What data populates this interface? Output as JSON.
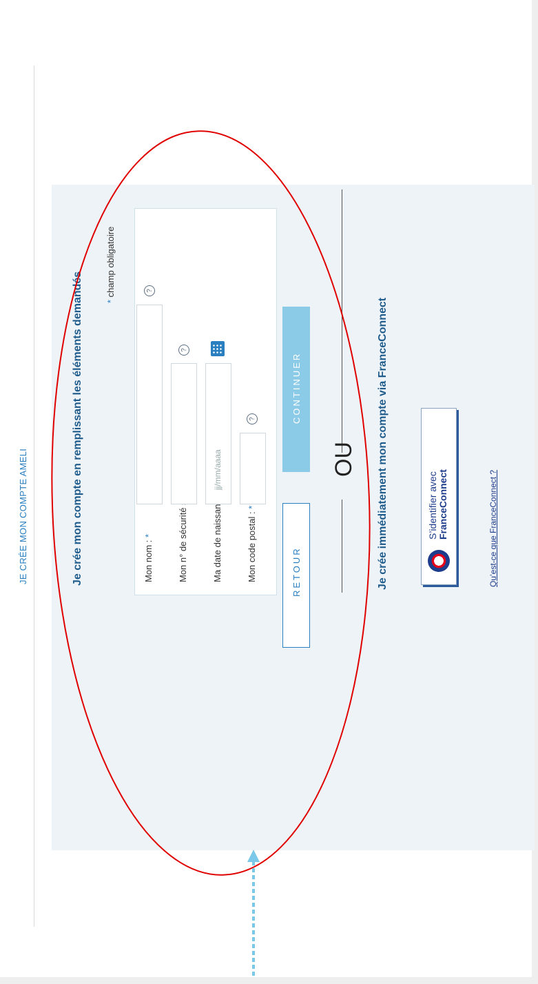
{
  "page": {
    "title": "JE CRÉE MON COMPTE AMELI"
  },
  "form": {
    "title": "Je crée mon compte en remplissant les éléments demandés",
    "required_note": "champ obligatoire",
    "required_star": "*",
    "fields": [
      {
        "label": "Mon nom :",
        "value": "",
        "placeholder": ""
      },
      {
        "label": "Mon n° de sécurité sociale :",
        "value": "",
        "placeholder": ""
      },
      {
        "label": "Ma date de naissance :",
        "value": "",
        "placeholder": "jj/mm/aaaa"
      },
      {
        "label": "Mon code postal :",
        "value": "",
        "placeholder": ""
      }
    ],
    "help_glyph": "?",
    "continue_label": "CONTINUER",
    "back_label": "RETOUR"
  },
  "separator": {
    "label": "OU"
  },
  "franceconnect": {
    "title": "Je crée immédiatement mon compte via FranceConnect",
    "button_line1": "S’identifier avec",
    "button_line2": "FranceConnect",
    "link_label": "Qu’est-ce que FranceConnect ?"
  },
  "colors": {
    "accent": "#2a7fc0",
    "panel": "#eef3f7",
    "highlight": "#e00000",
    "arrow": "#7cc8e8"
  }
}
